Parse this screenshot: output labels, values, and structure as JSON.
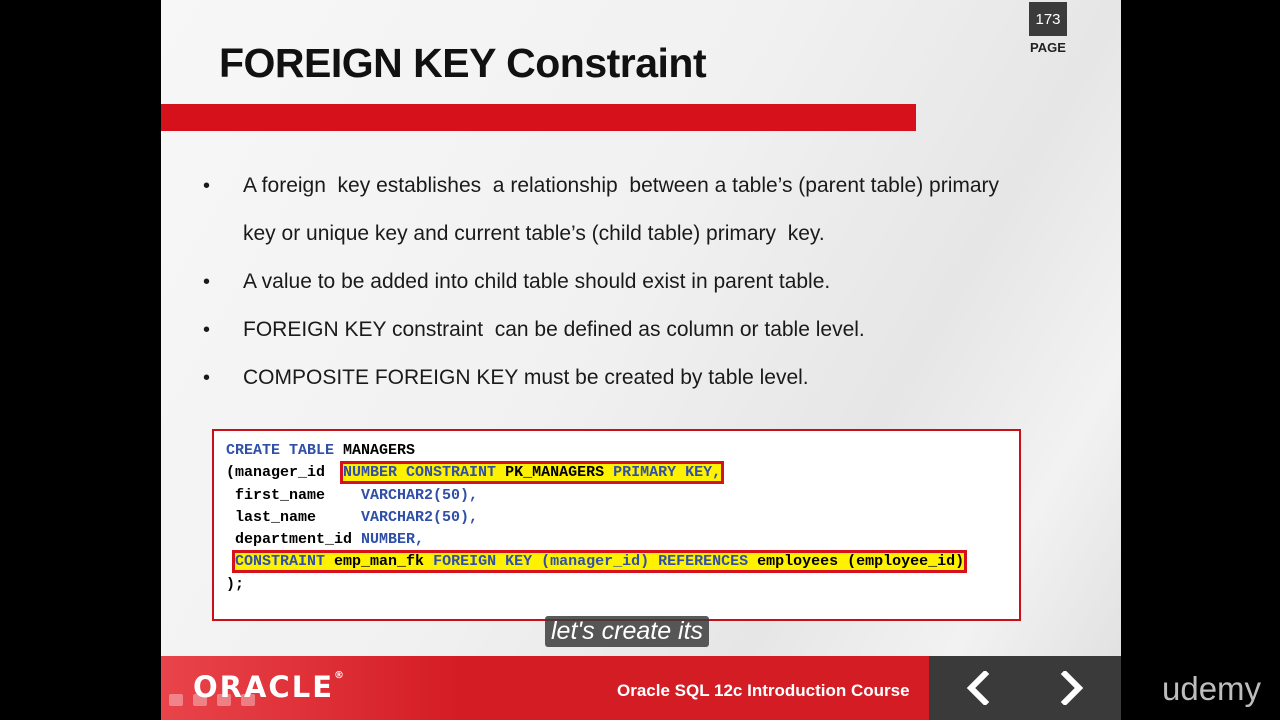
{
  "slide": {
    "title": "FOREIGN KEY Constraint",
    "page_number": "173",
    "page_label": "PAGE",
    "bullets": [
      {
        "text": "A foreign  key establishes  a relationship  between a table’s (parent table) primary"
      },
      {
        "text": "key or unique key and current table’s (child table) primary  key."
      },
      {
        "text": "A value to be added into child table should exist in parent table."
      },
      {
        "text": "FOREIGN KEY constraint  can be defined as column or table level."
      },
      {
        "text": "COMPOSITE FOREIGN KEY must be created by table level."
      }
    ],
    "code": {
      "l1_kw": "CREATE TABLE",
      "l1_name": " MANAGERS",
      "l2_col": "(manager_id  ",
      "l2_hl_kw1": "NUMBER CONSTRAINT",
      "l2_hl_name": " PK_MANAGERS ",
      "l2_hl_kw2": "PRIMARY KEY,",
      "l3_col": " first_name    ",
      "l3_type": "VARCHAR2",
      "l3_rest": "(50),",
      "l4_col": " last_name     ",
      "l4_type": "VARCHAR2",
      "l4_rest": "(50),",
      "l5_col": " department_id ",
      "l5_type": "NUMBER,",
      "l6_kw1": "CONSTRAINT",
      "l6_name": " emp_man_fk ",
      "l6_kw2": "FOREIGN KEY",
      "l6_paren1": " (manager_id) ",
      "l6_kw3": "REFERENCES",
      "l6_ref": " employees (employee_id)",
      "l7": ");"
    },
    "footer": {
      "logo_text": "ORACLE",
      "logo_mark": "®",
      "course_title": "Oracle SQL 12c Introduction Course",
      "prev_icon": "chevron-left-icon",
      "next_icon": "chevron-right-icon"
    }
  },
  "subtitle": "let's create its",
  "watermark": "udemy",
  "colors": {
    "accent_red": "#d7111b",
    "highlight_yellow": "#fff200",
    "keyword_blue": "#2f4fa8"
  }
}
